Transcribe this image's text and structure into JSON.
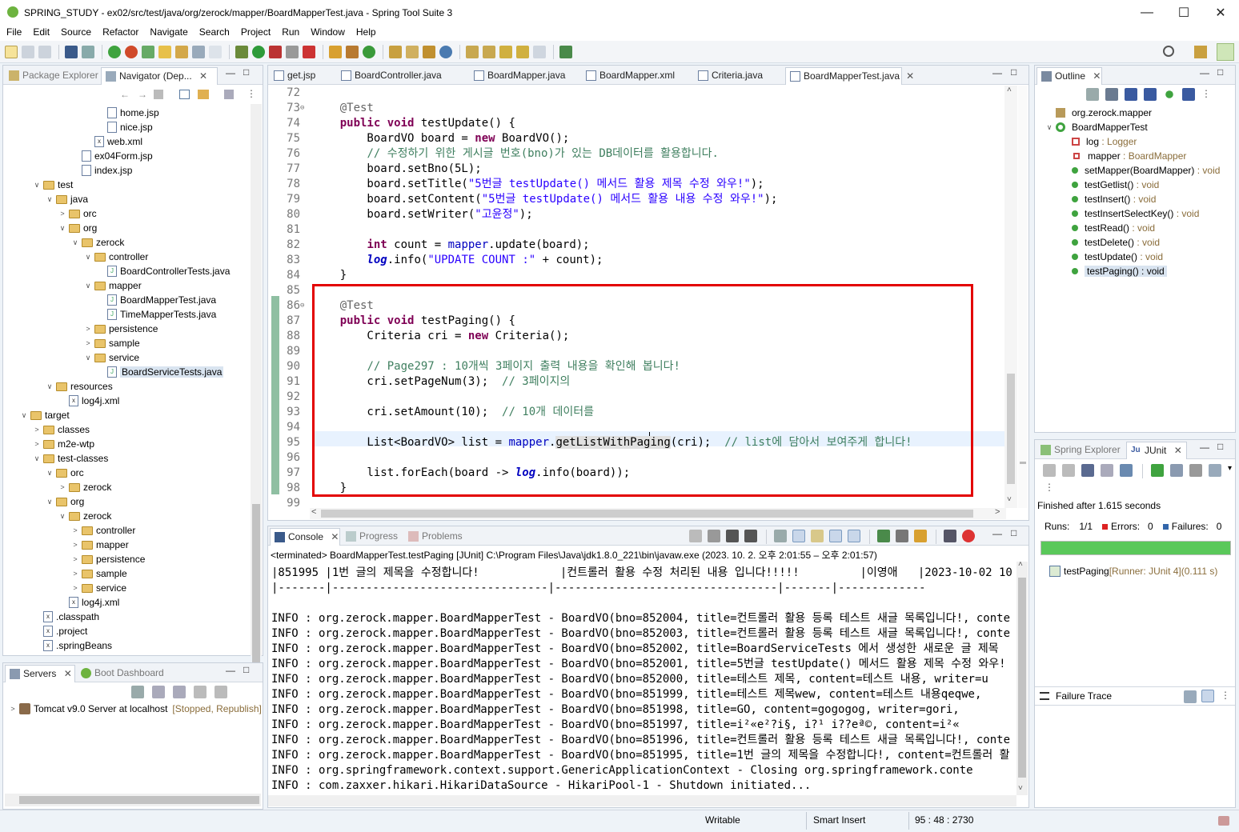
{
  "title": "SPRING_STUDY - ex02/src/test/java/org/zerock/mapper/BoardMapperTest.java - Spring Tool Suite 3",
  "menu": [
    "File",
    "Edit",
    "Source",
    "Refactor",
    "Navigate",
    "Search",
    "Project",
    "Run",
    "Window",
    "Help"
  ],
  "left_tabs": {
    "pkg": "Package Explorer",
    "nav": "Navigator (Dep..."
  },
  "tree": [
    {
      "d": 7,
      "t": "f",
      "label": "home.jsp"
    },
    {
      "d": 7,
      "t": "f",
      "label": "nice.jsp"
    },
    {
      "d": 6,
      "t": "x",
      "label": "web.xml"
    },
    {
      "d": 5,
      "t": "f",
      "label": "ex04Form.jsp"
    },
    {
      "d": 5,
      "t": "f",
      "label": "index.jsp"
    },
    {
      "d": 2,
      "t": "d",
      "o": "v",
      "label": "test"
    },
    {
      "d": 3,
      "t": "d",
      "o": "v",
      "label": "java"
    },
    {
      "d": 4,
      "t": "d",
      "o": ">",
      "label": "orc"
    },
    {
      "d": 4,
      "t": "d",
      "o": "v",
      "label": "org"
    },
    {
      "d": 5,
      "t": "d",
      "o": "v",
      "label": "zerock"
    },
    {
      "d": 6,
      "t": "d",
      "o": "v",
      "label": "controller"
    },
    {
      "d": 7,
      "t": "j",
      "label": "BoardControllerTests.java"
    },
    {
      "d": 6,
      "t": "d",
      "o": "v",
      "label": "mapper"
    },
    {
      "d": 7,
      "t": "j",
      "label": "BoardMapperTest.java"
    },
    {
      "d": 7,
      "t": "j",
      "label": "TimeMapperTests.java"
    },
    {
      "d": 6,
      "t": "d",
      "o": ">",
      "label": "persistence"
    },
    {
      "d": 6,
      "t": "d",
      "o": ">",
      "label": "sample"
    },
    {
      "d": 6,
      "t": "d",
      "o": "v",
      "label": "service"
    },
    {
      "d": 7,
      "t": "j",
      "label": "BoardServiceTests.java",
      "sel": true
    },
    {
      "d": 3,
      "t": "d",
      "o": "v",
      "label": "resources"
    },
    {
      "d": 4,
      "t": "x",
      "label": "log4j.xml"
    },
    {
      "d": 1,
      "t": "d",
      "o": "v",
      "label": "target"
    },
    {
      "d": 2,
      "t": "d",
      "o": ">",
      "label": "classes"
    },
    {
      "d": 2,
      "t": "d",
      "o": ">",
      "label": "m2e-wtp"
    },
    {
      "d": 2,
      "t": "d",
      "o": "v",
      "label": "test-classes"
    },
    {
      "d": 3,
      "t": "d",
      "o": "v",
      "label": "orc"
    },
    {
      "d": 4,
      "t": "d",
      "o": ">",
      "label": "zerock"
    },
    {
      "d": 3,
      "t": "d",
      "o": "v",
      "label": "org"
    },
    {
      "d": 4,
      "t": "d",
      "o": "v",
      "label": "zerock"
    },
    {
      "d": 5,
      "t": "d",
      "o": ">",
      "label": "controller"
    },
    {
      "d": 5,
      "t": "d",
      "o": ">",
      "label": "mapper"
    },
    {
      "d": 5,
      "t": "d",
      "o": ">",
      "label": "persistence"
    },
    {
      "d": 5,
      "t": "d",
      "o": ">",
      "label": "sample"
    },
    {
      "d": 5,
      "t": "d",
      "o": ">",
      "label": "service"
    },
    {
      "d": 4,
      "t": "x",
      "label": "log4j.xml"
    },
    {
      "d": 2,
      "t": "x",
      "label": ".classpath"
    },
    {
      "d": 2,
      "t": "x",
      "label": ".project"
    },
    {
      "d": 2,
      "t": "x",
      "label": ".springBeans"
    }
  ],
  "servers": {
    "tab": "Servers",
    "tab2": "Boot Dashboard",
    "item": "Tomcat v9.0 Server at localhost",
    "status": "[Stopped, Republish]"
  },
  "editor_tabs": [
    "get.jsp",
    "BoardController.java",
    "BoardMapper.java",
    "BoardMapper.xml",
    "Criteria.java",
    "BoardMapperTest.java"
  ],
  "code": [
    {
      "n": "72",
      "h": ""
    },
    {
      "n": "73",
      "h": "    <span class=an>@Test</span>"
    },
    {
      "n": "74",
      "h": "    <span class=kw>public</span> <span class=kw>void</span> testUpdate() {"
    },
    {
      "n": "75",
      "h": "        BoardVO board = <span class=kw>new</span> BoardVO();"
    },
    {
      "n": "76",
      "h": "        <span class=cm>// 수정하기 위한 게시글 번호(bno)가 있는 DB데이터를 활용합니다.</span>"
    },
    {
      "n": "77",
      "h": "        board.setBno(5L);"
    },
    {
      "n": "78",
      "h": "        board.setTitle(<span class=str>\"5번글 testUpdate() 메서드 활용 제목 수정 와우!\"</span>);"
    },
    {
      "n": "79",
      "h": "        board.setContent(<span class=str>\"5번글 testUpdate() 메서드 활용 내용 수정 와우!\"</span>);"
    },
    {
      "n": "80",
      "h": "        board.setWriter(<span class=str>\"고윤정\"</span>);"
    },
    {
      "n": "81",
      "h": ""
    },
    {
      "n": "82",
      "h": "        <span class=kw>int</span> count = <span class=fld>mapper</span>.update(board);"
    },
    {
      "n": "83",
      "h": "        <span class=sfld>log</span>.info(<span class=str>\"UPDATE COUNT :\"</span> + count);"
    },
    {
      "n": "84",
      "h": "    }"
    },
    {
      "n": "85",
      "h": ""
    },
    {
      "n": "86",
      "h": "    <span class=an>@Test</span>"
    },
    {
      "n": "87",
      "h": "    <span class=kw>public</span> <span class=kw>void</span> testPaging() {"
    },
    {
      "n": "88",
      "h": "        Criteria cri = <span class=kw>new</span> Criteria();"
    },
    {
      "n": "89",
      "h": ""
    },
    {
      "n": "90",
      "h": "        <span class=cm>// Page297 : 10개씩 3페이지 출력 내용을 확인해 봅니다!</span>"
    },
    {
      "n": "91",
      "h": "        cri.setPageNum(3);  <span class=cm>// 3페이지의</span>"
    },
    {
      "n": "92",
      "h": ""
    },
    {
      "n": "93",
      "h": "        cri.setAmount(10);  <span class=cm>// 10개 데이터를</span>"
    },
    {
      "n": "94",
      "h": ""
    },
    {
      "n": "95",
      "h": "        List&lt;BoardVO&gt; list = <span class=fld>mapper</span>.<span style='background:#e0e0e0'>getListWithPaging</span>(cri);  <span class=cm>// list에 담아서 보여주게 합니다!</span>"
    },
    {
      "n": "96",
      "h": ""
    },
    {
      "n": "97",
      "h": "        list.forEach(board -&gt; <span class=sfld>log</span>.info(board));"
    },
    {
      "n": "98",
      "h": "    }"
    },
    {
      "n": "99",
      "h": ""
    }
  ],
  "console": {
    "tabs": [
      "Console",
      "Progress",
      "Problems"
    ],
    "header": "<terminated> BoardMapperTest.testPaging [JUnit] C:\\Program Files\\Java\\jdk1.8.0_221\\bin\\javaw.exe  (2023. 10. 2. 오후 2:01:55 – 오후 2:01:57)",
    "lines": [
      "|851995 |1번 글의 제목을 수정합니다!            |컨트롤러 활용 수정 처리된 내용 입니다!!!!!         |이영애   |2023-10-02 10",
      "|-------|--------------------------------|---------------------------------|-------|-------------",
      "",
      "INFO : org.zerock.mapper.BoardMapperTest - BoardVO(bno=852004, title=컨트롤러 활용 등록 테스트 새글 목록입니다!, conte",
      "INFO : org.zerock.mapper.BoardMapperTest - BoardVO(bno=852003, title=컨트롤러 활용 등록 테스트 새글 목록입니다!, conte",
      "INFO : org.zerock.mapper.BoardMapperTest - BoardVO(bno=852002, title=BoardServiceTests 에서 생성한 새로운 글 제목",
      "INFO : org.zerock.mapper.BoardMapperTest - BoardVO(bno=852001, title=5번글 testUpdate() 메서드 활용 제목 수정 와우!",
      "INFO : org.zerock.mapper.BoardMapperTest - BoardVO(bno=852000, title=테스트 제목, content=테스트 내용, writer=u",
      "INFO : org.zerock.mapper.BoardMapperTest - BoardVO(bno=851999, title=테스트 제목wew, content=테스트 내용qeqwe, ",
      "INFO : org.zerock.mapper.BoardMapperTest - BoardVO(bno=851998, title=GO, content=gogogog, writer=gori, ",
      "INFO : org.zerock.mapper.BoardMapperTest - BoardVO(bno=851997, title=i²«e²?i§, i?¹ i??eª©, content=i²«",
      "INFO : org.zerock.mapper.BoardMapperTest - BoardVO(bno=851996, title=컨트롤러 활용 등록 테스트 새글 목록입니다!, conte",
      "INFO : org.zerock.mapper.BoardMapperTest - BoardVO(bno=851995, title=1번 글의 제목을 수정합니다!, content=컨트롤러 활",
      "INFO : org.springframework.context.support.GenericApplicationContext - Closing org.springframework.conte",
      "INFO : com.zaxxer.hikari.HikariDataSource - HikariPool-1 - Shutdown initiated..."
    ]
  },
  "outline": {
    "tab": "Outline",
    "items": [
      {
        "d": 1,
        "k": "pkg",
        "label": "org.zerock.mapper",
        "type": ""
      },
      {
        "d": 1,
        "k": "cls",
        "label": "BoardMapperTest",
        "type": ""
      },
      {
        "d": 2,
        "k": "sf",
        "label": "log",
        "type": " : Logger"
      },
      {
        "d": 2,
        "k": "priv",
        "label": "mapper",
        "type": " : BoardMapper"
      },
      {
        "d": 2,
        "k": "pub",
        "label": "setMapper(BoardMapper)",
        "type": " : void"
      },
      {
        "d": 2,
        "k": "pub",
        "label": "testGetlist()",
        "type": " : void"
      },
      {
        "d": 2,
        "k": "pub",
        "label": "testInsert()",
        "type": " : void"
      },
      {
        "d": 2,
        "k": "pub",
        "label": "testInsertSelectKey()",
        "type": " : void"
      },
      {
        "d": 2,
        "k": "pub",
        "label": "testRead()",
        "type": " : void"
      },
      {
        "d": 2,
        "k": "pub",
        "label": "testDelete()",
        "type": " : void"
      },
      {
        "d": 2,
        "k": "pub",
        "label": "testUpdate()",
        "type": " : void"
      },
      {
        "d": 2,
        "k": "pub",
        "label": "testPaging()",
        "type": " : void",
        "sel": true
      }
    ]
  },
  "junit": {
    "tab1": "Spring Explorer",
    "tab2": "JUnit",
    "finished": "Finished after 1.615 seconds",
    "runs_label": "Runs:",
    "runs": "1/1",
    "errors_label": "Errors:",
    "errors": "0",
    "failures_label": "Failures:",
    "failures": "0",
    "test_name": "testPaging",
    "test_runner": " [Runner: JUnit 4]",
    "test_time": " (0.111 s)",
    "failure_trace": "Failure Trace",
    "progress": 1.0
  },
  "status": {
    "writable": "Writable",
    "insert": "Smart Insert",
    "pos": "95 : 48 : 2730"
  }
}
